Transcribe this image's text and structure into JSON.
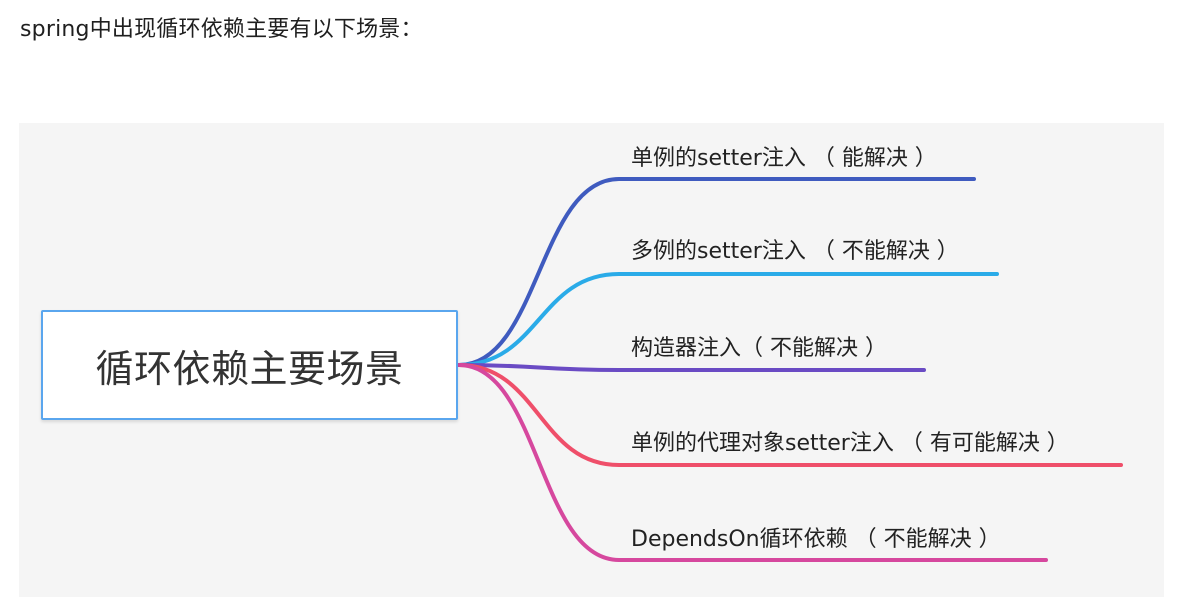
{
  "intro_text": "spring中出现循环依赖主要有以下场景：",
  "diagram": {
    "root_label": "循环依赖主要场景",
    "branches": [
      {
        "label": "单例的setter注入 （ 能解决 ）",
        "color": "#3f5bbf"
      },
      {
        "label": "多例的setter注入 （ 不能解决 ）",
        "color": "#2aabe8"
      },
      {
        "label": "构造器注入（ 不能解决 ）",
        "color": "#6a4bc4"
      },
      {
        "label": "单例的代理对象setter注入 （ 有可能解决 ）",
        "color": "#ef4f6a"
      },
      {
        "label": "DependsOn循环依赖 （ 不能解决 ）",
        "color": "#d6489e"
      }
    ]
  }
}
